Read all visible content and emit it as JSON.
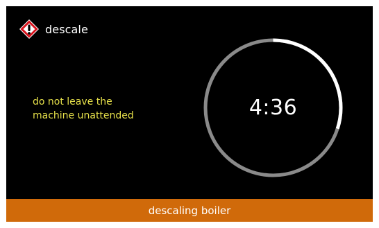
{
  "header": {
    "icon": "warning-diamond-icon",
    "title": "descale"
  },
  "message": {
    "lines": [
      "do not leave the",
      "machine unattended"
    ]
  },
  "timer": {
    "time": "4:36",
    "progress": 0.3
  },
  "status_bar": {
    "text": "descaling boiler"
  },
  "colors": {
    "background": "#000000",
    "message_text": "#e6e04a",
    "status_bar": "#d06a0a",
    "ring_track": "#8a8a8a",
    "ring_progress": "#ffffff",
    "warning_icon_border": "#d8121c"
  }
}
